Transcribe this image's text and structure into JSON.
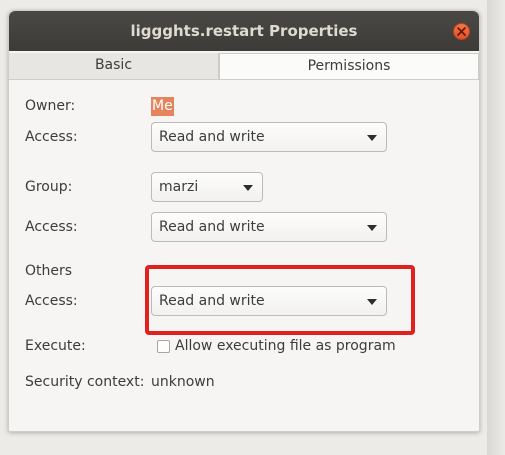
{
  "window": {
    "title": "liggghts.restart Properties",
    "close_icon": "close-icon"
  },
  "tabs": [
    {
      "label": "Basic",
      "active": false
    },
    {
      "label": "Permissions",
      "active": true
    }
  ],
  "owner": {
    "label": "Owner:",
    "value": "Me",
    "access_label": "Access:",
    "access_value": "Read and write"
  },
  "group": {
    "label": "Group:",
    "value": "marzi",
    "access_label": "Access:",
    "access_value": "Read and write"
  },
  "others": {
    "label": "Others",
    "access_label": "Access:",
    "access_value": "Read and write",
    "highlight_color": "#e0211d"
  },
  "execute": {
    "label": "Execute:",
    "checkbox_label": "Allow executing file as program",
    "checked": false
  },
  "security": {
    "label": "Security context:",
    "value": "unknown"
  },
  "colors": {
    "accent": "#e6845e",
    "titlebar": "#3c3b37",
    "close_button": "#e45126"
  }
}
